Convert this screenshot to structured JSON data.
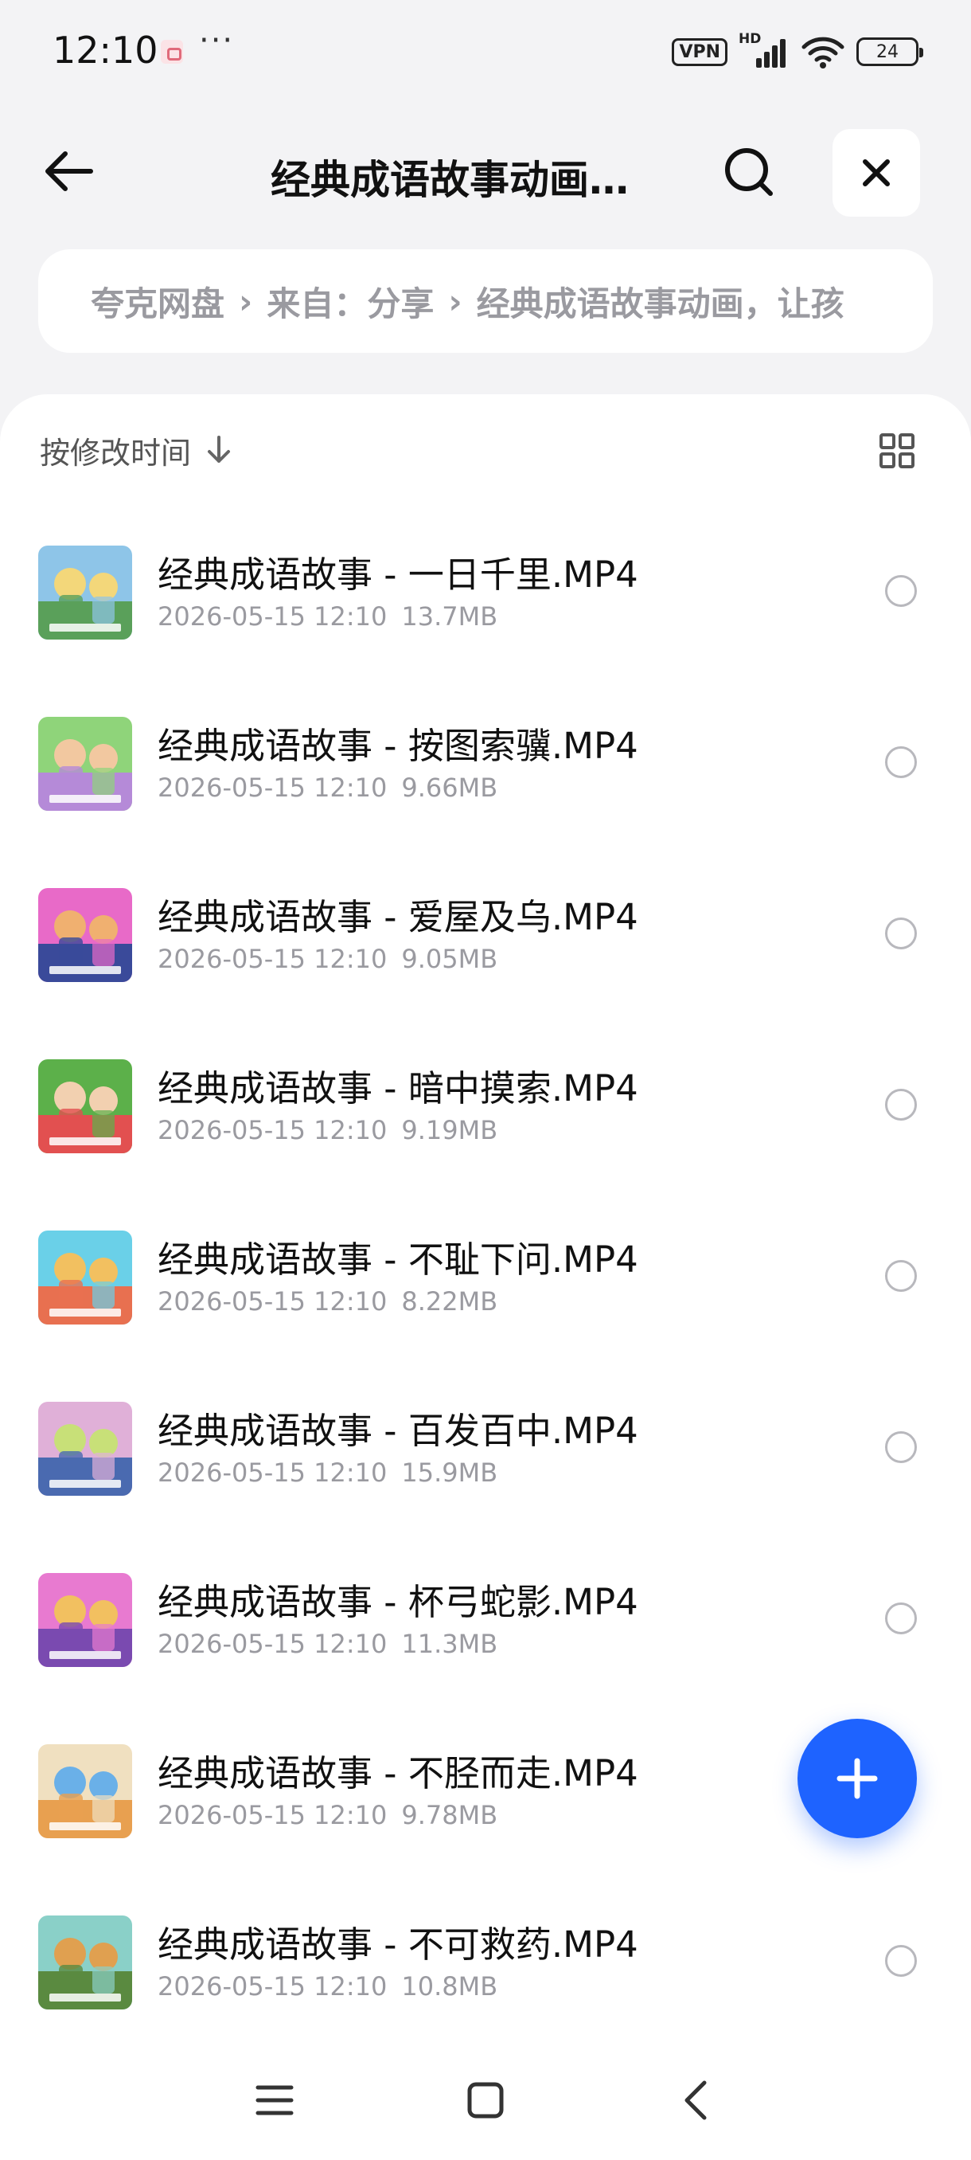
{
  "status_bar": {
    "time": "12:10",
    "more": "···",
    "vpn": "VPN",
    "hd": "HD",
    "battery": "24"
  },
  "header": {
    "title": "经典成语故事动画…",
    "back_icon": "arrow-left-icon",
    "search_icon": "search-icon",
    "close_icon": "close-icon"
  },
  "breadcrumb": {
    "items": [
      "夸克网盘",
      "来自：分享",
      "经典成语故事动画，让孩"
    ],
    "separator": "›"
  },
  "sort": {
    "label": "按修改时间",
    "direction_icon": "arrow-down-icon",
    "view_toggle_icon": "grid-view-icon"
  },
  "files": [
    {
      "name": "经典成语故事 - 一日千里.MP4",
      "date": "2026-05-15 12:10",
      "size": "13.7MB",
      "thumb_colors": [
        "#8ec5e8",
        "#f3d77a",
        "#5aa05a"
      ]
    },
    {
      "name": "经典成语故事 - 按图索骥.MP4",
      "date": "2026-05-15 12:10",
      "size": "9.66MB",
      "thumb_colors": [
        "#8fd47a",
        "#f2c8a0",
        "#b58ad8"
      ]
    },
    {
      "name": "经典成语故事 - 爱屋及乌.MP4",
      "date": "2026-05-15 12:10",
      "size": "9.05MB",
      "thumb_colors": [
        "#e86ac8",
        "#f0b070",
        "#3a4a9a"
      ]
    },
    {
      "name": "经典成语故事 - 暗中摸索.MP4",
      "date": "2026-05-15 12:10",
      "size": "9.19MB",
      "thumb_colors": [
        "#5cb04a",
        "#f2d0b0",
        "#e25050"
      ]
    },
    {
      "name": "经典成语故事 - 不耻下问.MP4",
      "date": "2026-05-15 12:10",
      "size": "8.22MB",
      "thumb_colors": [
        "#6ad0e8",
        "#f2c060",
        "#e87050"
      ]
    },
    {
      "name": "经典成语故事 - 百发百中.MP4",
      "date": "2026-05-15 12:10",
      "size": "15.9MB",
      "thumb_colors": [
        "#e0b0d8",
        "#c8e078",
        "#4a6ab0"
      ]
    },
    {
      "name": "经典成语故事 - 杯弓蛇影.MP4",
      "date": "2026-05-15 12:10",
      "size": "11.3MB",
      "thumb_colors": [
        "#e87ad0",
        "#f2c060",
        "#7a4ab0"
      ]
    },
    {
      "name": "经典成语故事 - 不胫而走.MP4",
      "date": "2026-05-15 12:10",
      "size": "9.78MB",
      "thumb_colors": [
        "#f0e0c0",
        "#6ab0e8",
        "#e8a050"
      ]
    },
    {
      "name": "经典成语故事 - 不可救药.MP4",
      "date": "2026-05-15 12:10",
      "size": "10.8MB",
      "thumb_colors": [
        "#8ad0c8",
        "#e0a050",
        "#5a8a40"
      ]
    }
  ],
  "fab": {
    "icon": "plus-icon",
    "color": "#1e63ff"
  },
  "nav_bar": {
    "icons": [
      "menu-icon",
      "home-square-icon",
      "back-chevron-icon"
    ]
  }
}
